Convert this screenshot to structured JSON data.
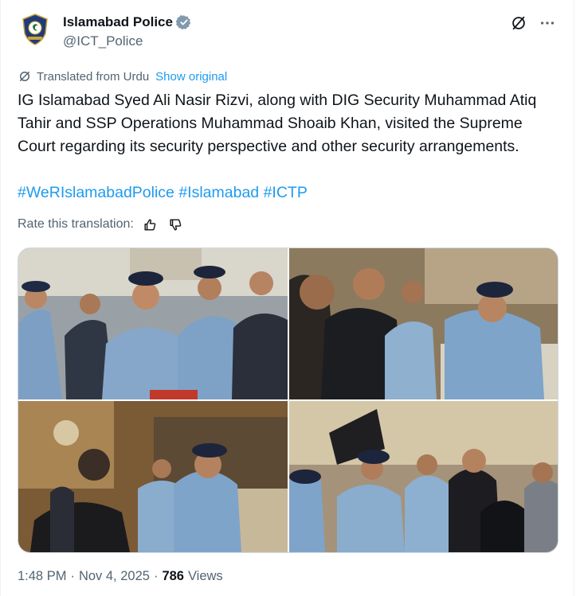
{
  "author": {
    "display_name": "Islamabad Police",
    "handle": "@ICT_Police",
    "avatar_icon": "police-crest-icon",
    "verified_color": "#829aab"
  },
  "translation": {
    "label": "Translated from Urdu",
    "show_original": "Show original"
  },
  "tweet": {
    "text": "IG Islamabad Syed Ali Nasir Rizvi, along with DIG Security Muhammad Atiq Tahir and SSP Operations Muhammad Shoaib Khan, visited the Supreme Court regarding its security perspective and other security arrangements.",
    "hashtags": [
      "#WeRIslamabadPolice",
      "#Islamabad",
      "#ICTP"
    ]
  },
  "rate": {
    "label": "Rate this translation:"
  },
  "meta": {
    "time": "1:48 PM",
    "separator": "·",
    "date": "Nov 4, 2025",
    "views_count": "786",
    "views_label": "Views"
  },
  "colors": {
    "text": "#0f1419",
    "secondary": "#536471",
    "link": "#1d9bf0",
    "uniform": "#7fa3c9",
    "cap": "#1f2a44"
  }
}
